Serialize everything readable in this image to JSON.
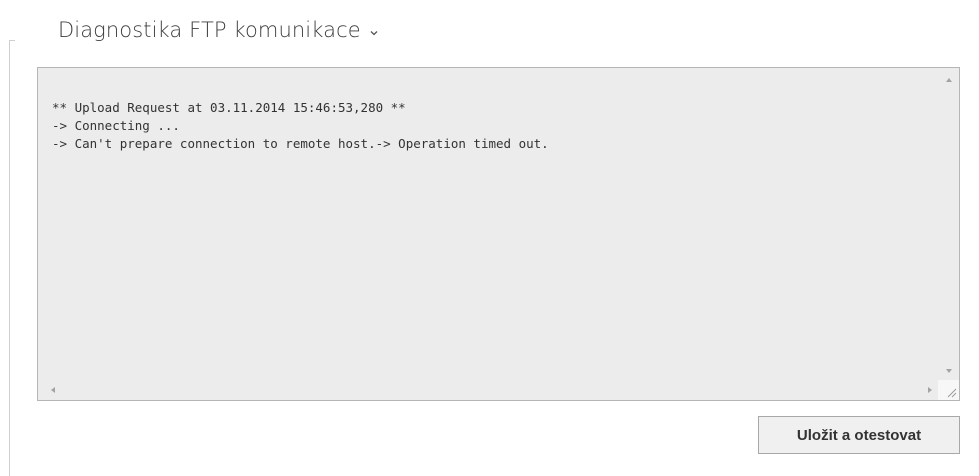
{
  "section": {
    "title": "Diagnostika FTP komunikace",
    "chevron_icon": "chevron-down-icon"
  },
  "log": {
    "lines": [
      "** Upload Request at 03.11.2014 15:46:53,280 **",
      "-> Connecting ...",
      "-> Can't prepare connection to remote host.-> Operation timed out."
    ]
  },
  "actions": {
    "save_test_label": "Uložit a otestovat"
  },
  "colors": {
    "log_background": "#ececec",
    "log_border": "#b5b5b5",
    "title_text": "#3d3d3d",
    "button_background": "#f0f0f0"
  }
}
